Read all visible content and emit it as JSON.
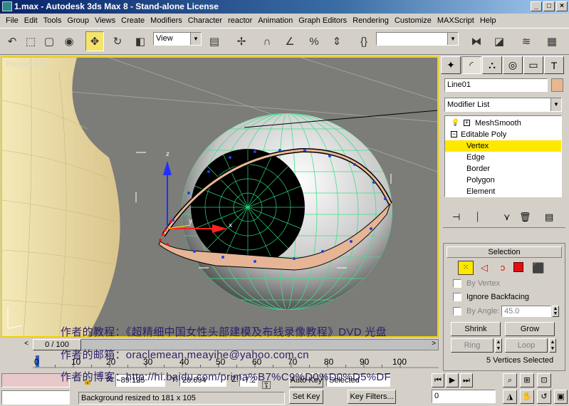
{
  "window": {
    "title": "1.max - Autodesk 3ds Max 8 - Stand-alone License",
    "controls": {
      "minimize": "_",
      "maximize": "□",
      "close": "×"
    }
  },
  "menu": [
    "File",
    "Edit",
    "Tools",
    "Group",
    "Views",
    "Create",
    "Modifiers",
    "Character",
    "reactor",
    "Animation",
    "Graph Editors",
    "Rendering",
    "Customize",
    "MAXScript",
    "Help"
  ],
  "toolbar": {
    "view_dropdown": "View",
    "named_selection": "",
    "icons": [
      "undo-icon",
      "select-icon",
      "region-select-icon",
      "select-by-name-icon",
      "move-icon",
      "rotate-icon",
      "scale-icon",
      "pivot-icon",
      "manipulate-icon",
      "snap-icon",
      "angle-snap-icon",
      "percent-snap-icon",
      "spinner-snap-icon",
      "named-sets-icon",
      "mirror-icon",
      "align-icon",
      "layer-icon",
      "curve-editor-icon",
      "schematic-icon"
    ]
  },
  "viewport": {
    "label": "Perspective",
    "gizmo_axes": {
      "x": "x",
      "y": "y",
      "z": "z"
    }
  },
  "watermark": {
    "line1": "作者的教程：《超精细中国女性头部建模及布线录像教程》DVD 光盘",
    "line2": "作者的邮箱：oraclemean.meayihe@yahoo.com.cn",
    "line3": "作者的博客：http://hi.baidu.com/prima%B7%C9%D0%D0%D5%DF"
  },
  "timeline": {
    "frame_display": "0 / 100",
    "ticks": [
      "0",
      "10",
      "20",
      "30",
      "40",
      "50",
      "60",
      "70",
      "80",
      "90",
      "100"
    ],
    "prev_arrow": "<",
    "next_arrow": ">"
  },
  "status": {
    "x_label": "X:",
    "x_value": "-89.125",
    "y_label": "Y:",
    "y_value": "20.694",
    "z_label": "Z:",
    "z_value": "-7.2",
    "prompt": "Background resized to 181 x 105",
    "auto_key": "Auto Key",
    "set_key": "Set Key",
    "key_mode": "Selected",
    "key_filters": "Key Filters...",
    "frame_value": "0"
  },
  "command_panel": {
    "object_name": "Line01",
    "object_color": "#e8b690",
    "modifier_list": "Modifier List",
    "stack": [
      {
        "label": "MeshSmooth",
        "level": 0,
        "selected": false
      },
      {
        "label": "Editable Poly",
        "level": 0,
        "selected": false
      },
      {
        "label": "Vertex",
        "level": 1,
        "selected": true
      },
      {
        "label": "Edge",
        "level": 1,
        "selected": false
      },
      {
        "label": "Border",
        "level": 1,
        "selected": false
      },
      {
        "label": "Polygon",
        "level": 1,
        "selected": false
      },
      {
        "label": "Element",
        "level": 1,
        "selected": false
      }
    ],
    "selection_rollout": {
      "title": "Selection",
      "by_vertex": "By Vertex",
      "ignore_backfacing": "Ignore Backfacing",
      "by_angle": "By Angle:",
      "angle_value": "45.0",
      "shrink": "Shrink",
      "grow": "Grow",
      "ring": "Ring",
      "loop": "Loop",
      "status": "5 Vertices Selected"
    }
  }
}
